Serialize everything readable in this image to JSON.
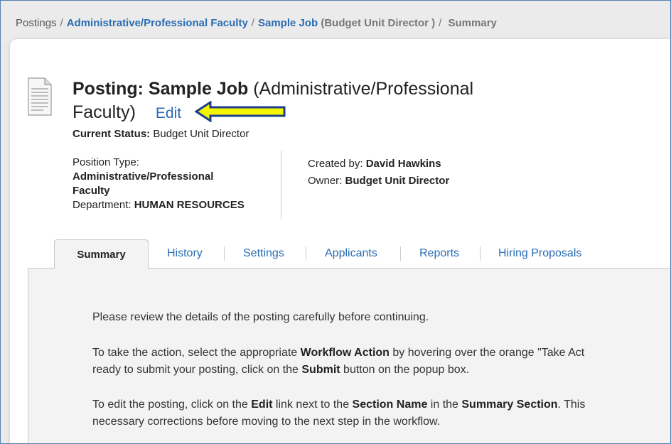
{
  "breadcrumb": {
    "root": "Postings",
    "category": "Administrative/Professional Faculty",
    "job": "Sample Job",
    "job_state": "(Budget Unit Director )",
    "current": "Summary"
  },
  "posting": {
    "title_prefix": "Posting: Sample Job",
    "title_suffix_line1": "(Administrative/Professional",
    "title_suffix_line2": "Faculty)",
    "edit_label": "Edit",
    "status_label": "Current Status:",
    "status_value": "Budget Unit Director"
  },
  "details": {
    "position_type_label": "Position Type:",
    "position_type_value": "Administrative/Professional Faculty",
    "department_label": "Department:",
    "department_value": "HUMAN RESOURCES",
    "created_by_label": "Created by:",
    "created_by_value": "David Hawkins",
    "owner_label": "Owner:",
    "owner_value": "Budget Unit Director"
  },
  "tabs": [
    {
      "label": "Summary"
    },
    {
      "label": "History"
    },
    {
      "label": "Settings"
    },
    {
      "label": "Applicants"
    },
    {
      "label": "Reports"
    },
    {
      "label": "Hiring Proposals"
    }
  ],
  "content": {
    "p1": "Please review the details of the posting carefully before continuing.",
    "p2_a": "To take the action, select the appropriate ",
    "p2_b": "Workflow Action",
    "p2_c": " by hovering over the orange \"Take Act",
    "p2_d": "ready to submit your posting, click on the ",
    "p2_e": "Submit",
    "p2_f": " button on the popup box.",
    "p3_a": "To edit the posting, click on the ",
    "p3_b": "Edit",
    "p3_c": " link next to the ",
    "p3_d": "Section Name",
    "p3_e": " in the ",
    "p3_f": "Summary Section",
    "p3_g": ". This",
    "p3_h": "necessary corrections before moving to the next step in the workflow."
  },
  "colors": {
    "link": "#2a6db3",
    "arrow_fill": "#f5f500",
    "arrow_stroke": "#1d3f88"
  }
}
